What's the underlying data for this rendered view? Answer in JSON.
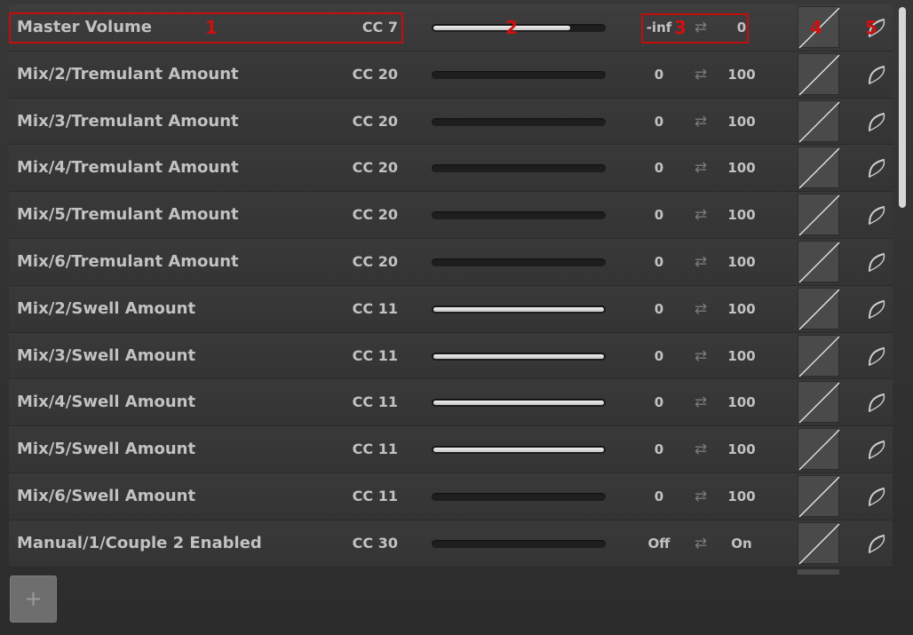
{
  "rows": [
    {
      "name": "Master Volume",
      "cc": "CC 7",
      "min": "-inf",
      "max": "0",
      "slider_fill": 0.8
    },
    {
      "name": "Mix/2/Tremulant Amount",
      "cc": "CC 20",
      "min": "0",
      "max": "100",
      "slider_fill": 0
    },
    {
      "name": "Mix/3/Tremulant Amount",
      "cc": "CC 20",
      "min": "0",
      "max": "100",
      "slider_fill": 0
    },
    {
      "name": "Mix/4/Tremulant Amount",
      "cc": "CC 20",
      "min": "0",
      "max": "100",
      "slider_fill": 0
    },
    {
      "name": "Mix/5/Tremulant Amount",
      "cc": "CC 20",
      "min": "0",
      "max": "100",
      "slider_fill": 0
    },
    {
      "name": "Mix/6/Tremulant Amount",
      "cc": "CC 20",
      "min": "0",
      "max": "100",
      "slider_fill": 0
    },
    {
      "name": "Mix/2/Swell Amount",
      "cc": "CC 11",
      "min": "0",
      "max": "100",
      "slider_fill": 1
    },
    {
      "name": "Mix/3/Swell Amount",
      "cc": "CC 11",
      "min": "0",
      "max": "100",
      "slider_fill": 1
    },
    {
      "name": "Mix/4/Swell Amount",
      "cc": "CC 11",
      "min": "0",
      "max": "100",
      "slider_fill": 1
    },
    {
      "name": "Mix/5/Swell Amount",
      "cc": "CC 11",
      "min": "0",
      "max": "100",
      "slider_fill": 1
    },
    {
      "name": "Mix/6/Swell Amount",
      "cc": "CC 11",
      "min": "0",
      "max": "100",
      "slider_fill": 0
    },
    {
      "name": "Manual/1/Couple 2 Enabled",
      "cc": "CC 30",
      "min": "Off",
      "max": "On",
      "slider_fill": 0
    }
  ],
  "swap_icon": "⇄",
  "add_button_label": "+",
  "annotations": [
    "1",
    "2",
    "3",
    "4",
    "5"
  ],
  "colors": {
    "annotation": "#c40d0d",
    "slider_fill": "#e0e0e0",
    "background": "#333333"
  }
}
